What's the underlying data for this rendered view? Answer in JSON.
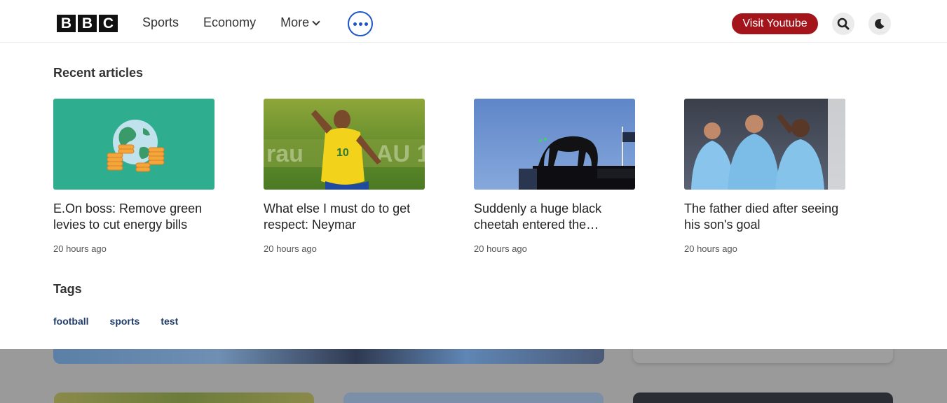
{
  "header": {
    "logo_letters": [
      "B",
      "B",
      "C"
    ],
    "nav": [
      {
        "label": "Sports"
      },
      {
        "label": "Economy"
      },
      {
        "label": "More"
      }
    ],
    "youtube_label": "Visit Youtube",
    "search_icon": "search-icon",
    "theme_icon": "moon-icon",
    "more_icon": "ellipsis-icon",
    "accent": "#1a56c8",
    "brand_red": "#a3141b"
  },
  "recent": {
    "title": "Recent articles",
    "articles": [
      {
        "title": "E.On boss: Remove green levies to cut energy bills",
        "time": "20 hours ago",
        "thumb": "globe-coins-illustration"
      },
      {
        "title": "What else I must do to get respect: Neymar",
        "time": "20 hours ago",
        "thumb": "footballer-yellow-jersey"
      },
      {
        "title": "Suddenly a huge black cheetah entered the…",
        "time": "20 hours ago",
        "thumb": "black-panther-statue"
      },
      {
        "title": "The father died after seeing his son's goal",
        "time": "20 hours ago",
        "thumb": "players-celebrating"
      }
    ]
  },
  "tags": {
    "title": "Tags",
    "items": [
      "football",
      "sports",
      "test"
    ]
  }
}
